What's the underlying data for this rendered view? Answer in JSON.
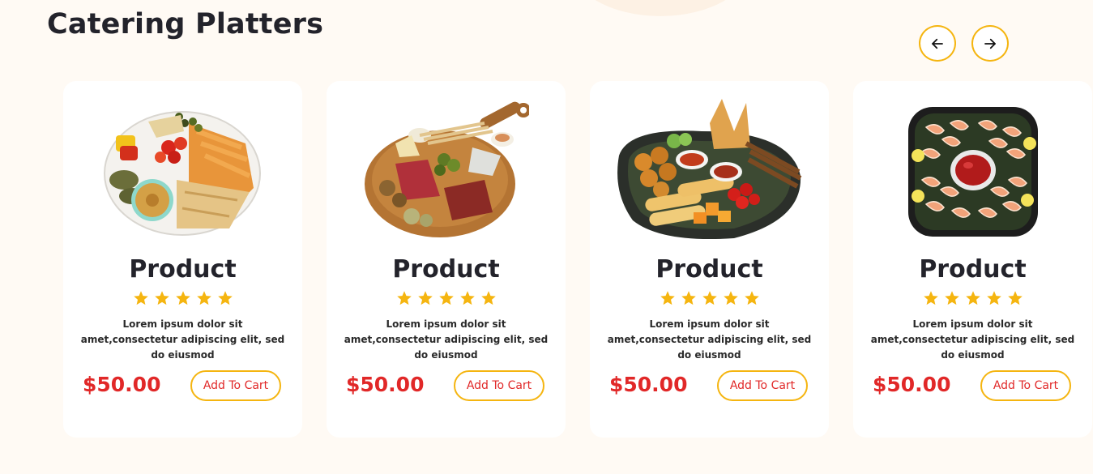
{
  "section": {
    "title": "Catering Platters",
    "prev_icon": "arrow-left-icon",
    "next_icon": "arrow-right-icon"
  },
  "colors": {
    "accent": "#f5b510",
    "price": "#e12828",
    "background": "#fffaf4",
    "card": "#ffffff"
  },
  "products": [
    {
      "name": "Product",
      "rating": 5,
      "description": "Lorem ipsum dolor sit amet,consectetur adipiscing elit, sed do eiusmod",
      "price": "$50.00",
      "cta": "Add To Cart"
    },
    {
      "name": "Product",
      "rating": 5,
      "description": "Lorem ipsum dolor sit amet,consectetur adipiscing elit, sed do eiusmod",
      "price": "$50.00",
      "cta": "Add To Cart"
    },
    {
      "name": "Product",
      "rating": 5,
      "description": "Lorem ipsum dolor sit amet,consectetur adipiscing elit, sed do eiusmod",
      "price": "$50.00",
      "cta": "Add To Cart"
    },
    {
      "name": "Product",
      "rating": 5,
      "description": "Lorem ipsum dolor sit amet,consectetur adipiscing elit, sed do eiusmod",
      "price": "$50.00",
      "cta": "Add To Cart"
    }
  ]
}
